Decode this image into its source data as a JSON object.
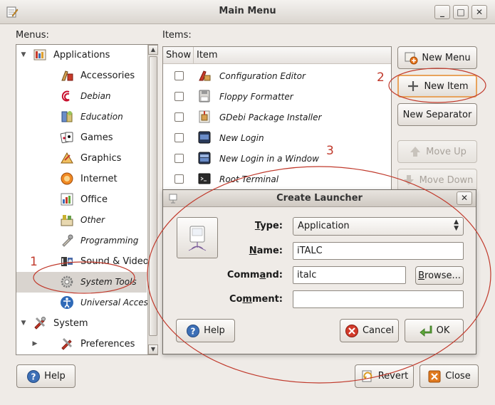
{
  "window": {
    "title": "Main Menu",
    "controls": {
      "minimize": "_",
      "maximize": "□",
      "close": "✕"
    }
  },
  "menus": {
    "label": "Menus:",
    "tree": [
      {
        "label": "Applications",
        "level": 0,
        "expanded": true,
        "italic": false,
        "icon": "applications-icon"
      },
      {
        "label": "Accessories",
        "level": 1,
        "italic": false,
        "icon": "accessories-icon"
      },
      {
        "label": "Debian",
        "level": 1,
        "italic": true,
        "icon": "debian-icon"
      },
      {
        "label": "Education",
        "level": 1,
        "italic": true,
        "icon": "education-icon"
      },
      {
        "label": "Games",
        "level": 1,
        "italic": false,
        "icon": "games-icon"
      },
      {
        "label": "Graphics",
        "level": 1,
        "italic": false,
        "icon": "graphics-icon"
      },
      {
        "label": "Internet",
        "level": 1,
        "italic": false,
        "icon": "internet-icon"
      },
      {
        "label": "Office",
        "level": 1,
        "italic": false,
        "icon": "office-icon"
      },
      {
        "label": "Other",
        "level": 1,
        "italic": true,
        "icon": "other-icon"
      },
      {
        "label": "Programming",
        "level": 1,
        "italic": true,
        "icon": "programming-icon"
      },
      {
        "label": "Sound & Video",
        "level": 1,
        "italic": false,
        "icon": "sound-video-icon"
      },
      {
        "label": "System Tools",
        "level": 1,
        "italic": true,
        "icon": "system-tools-icon",
        "selected": true
      },
      {
        "label": "Universal Access",
        "level": 1,
        "italic": true,
        "icon": "universal-access-icon"
      },
      {
        "label": "System",
        "level": 0,
        "expanded": true,
        "italic": false,
        "icon": "system-icon"
      },
      {
        "label": "Preferences",
        "level": 1,
        "collapsed": true,
        "italic": false,
        "icon": "preferences-icon"
      }
    ]
  },
  "items": {
    "label": "Items:",
    "columns": {
      "show": "Show",
      "item": "Item"
    },
    "rows": [
      {
        "label": "Configuration Editor",
        "icon": "config-editor-icon"
      },
      {
        "label": "Floppy Formatter",
        "icon": "floppy-icon"
      },
      {
        "label": "GDebi Package Installer",
        "icon": "package-icon"
      },
      {
        "label": "New Login",
        "icon": "login-icon"
      },
      {
        "label": "New Login in a Window",
        "icon": "login-window-icon"
      },
      {
        "label": "Root Terminal",
        "icon": "terminal-icon"
      }
    ]
  },
  "side_buttons": {
    "new_menu": "New Menu",
    "new_item": "New Item",
    "new_separator": "New Separator",
    "move_up": "Move Up",
    "move_down": "Move Down"
  },
  "bottom_buttons": {
    "help": "Help",
    "revert": "Revert",
    "close": "Close"
  },
  "dialog": {
    "title": "Create Launcher",
    "close": "✕",
    "type_label": "Type:",
    "type_value": "Application",
    "name_label": "Name:",
    "name_value": "iTALC",
    "command_label": "Command:",
    "command_value": "italc",
    "browse": "Browse...",
    "comment_label": "Comment:",
    "comment_value": "",
    "help": "Help",
    "cancel": "Cancel",
    "ok": "OK"
  },
  "annotations": {
    "one": "1",
    "two": "2",
    "three": "3"
  },
  "colors": {
    "annotation": "#c0392b",
    "focus": "#e8a35c",
    "window_bg": "#efebe7"
  }
}
